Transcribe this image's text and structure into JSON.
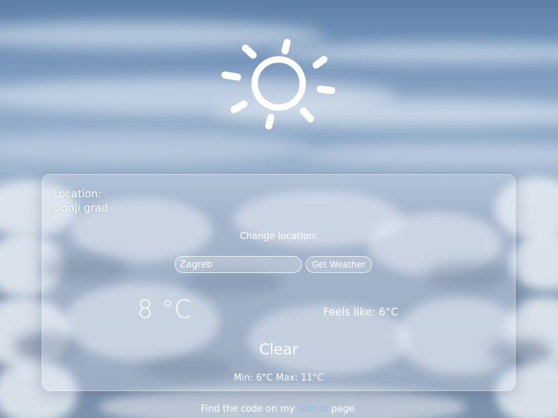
{
  "location": {
    "label": "Location:",
    "name": "Donji grad"
  },
  "change_location": {
    "label": "Change location:",
    "input_value": "Zagreb",
    "button_label": "Get Weather"
  },
  "weather": {
    "temperature": "8 °C",
    "feels_like_label": "Feels like:",
    "feels_like_value": "6°C",
    "condition": "Clear",
    "min_label": "Min:",
    "min_value": "6°C",
    "max_label": "Max:",
    "max_value": "11°C",
    "icon": "sun-icon"
  },
  "footer": {
    "prefix": "Find the code on my",
    "link_label": "Github",
    "suffix": "page."
  },
  "colors": {
    "text": "#ffffff",
    "link": "#8fb7ee"
  }
}
